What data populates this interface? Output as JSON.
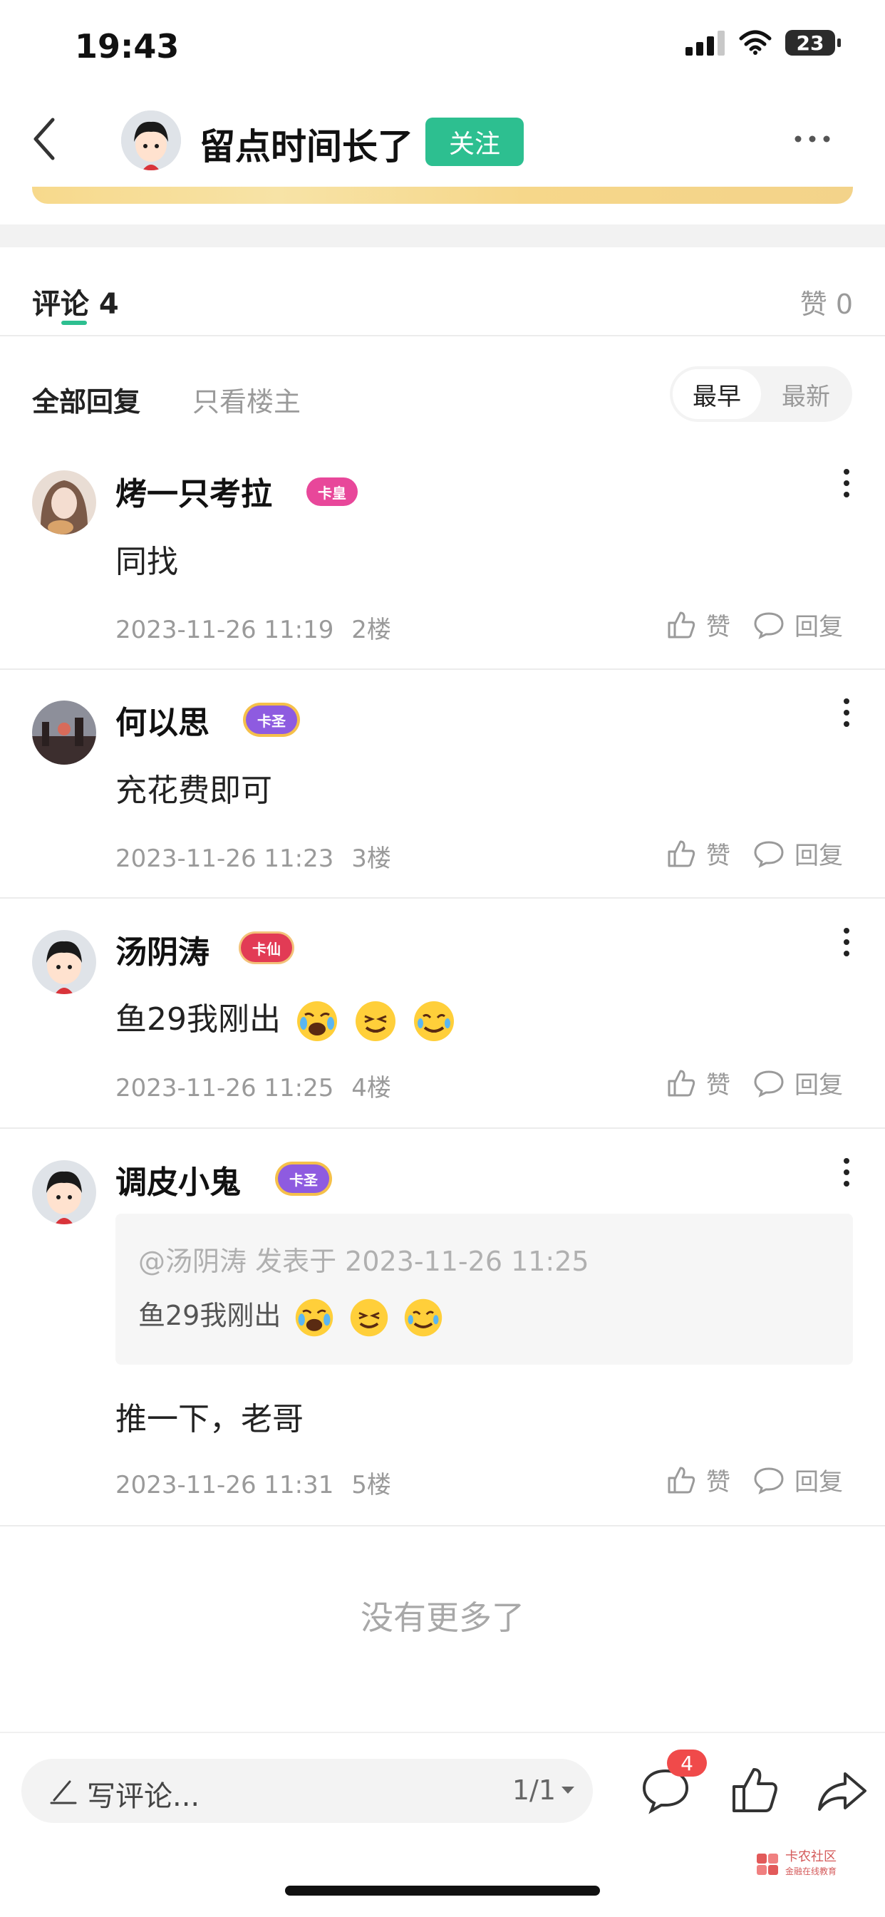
{
  "status_bar": {
    "time": "19:43",
    "battery": "23"
  },
  "header": {
    "title": "留点时间长了",
    "follow_label": "关注"
  },
  "tabs": {
    "comments_label": "评论 4",
    "likes_label": "赞 0"
  },
  "filters": {
    "all_label": "全部回复",
    "op_only_label": "只看楼主",
    "sort_earliest": "最早",
    "sort_latest": "最新"
  },
  "comments": [
    {
      "name": "烤一只考拉",
      "badge": "卡皇",
      "badge_color": "#e8479a",
      "body": "同找",
      "timestamp": "2023-11-26 11:19",
      "floor": "2楼",
      "like_label": "赞",
      "reply_label": "回复"
    },
    {
      "name": "何以思",
      "badge": "卡圣",
      "badge_color": "#8e5be0",
      "body": "充花费即可",
      "timestamp": "2023-11-26 11:23",
      "floor": "3楼",
      "like_label": "赞",
      "reply_label": "回复"
    },
    {
      "name": "汤阴涛",
      "badge": "卡仙",
      "badge_color": "#e23b55",
      "body": "鱼29我刚出",
      "timestamp": "2023-11-26 11:25",
      "floor": "4楼",
      "like_label": "赞",
      "reply_label": "回复"
    },
    {
      "name": "调皮小鬼",
      "badge": "卡圣",
      "badge_color": "#8e5be0",
      "quote_header": "@汤阴涛 发表于 2023-11-26 11:25",
      "quote_body": "鱼29我刚出",
      "body": "推一下，老哥",
      "timestamp": "2023-11-26 11:31",
      "floor": "5楼",
      "like_label": "赞",
      "reply_label": "回复"
    }
  ],
  "no_more_text": "没有更多了",
  "bottom_bar": {
    "input_placeholder": "写评论...",
    "page_indicator": "1/1",
    "comment_count": "4"
  },
  "watermark": {
    "line1": "卡农社区",
    "line2": "金融在线教育"
  },
  "icons": [
    "back-icon",
    "more-icon",
    "kebab-icon",
    "like-icon",
    "reply-icon",
    "pen-icon",
    "comment-icon",
    "thumb-up-icon",
    "share-icon",
    "signal-icon",
    "wifi-icon"
  ],
  "colors": {
    "accent": "#2dbf90",
    "badge_red": "#f04a4a",
    "muted": "#9a9a9a"
  }
}
